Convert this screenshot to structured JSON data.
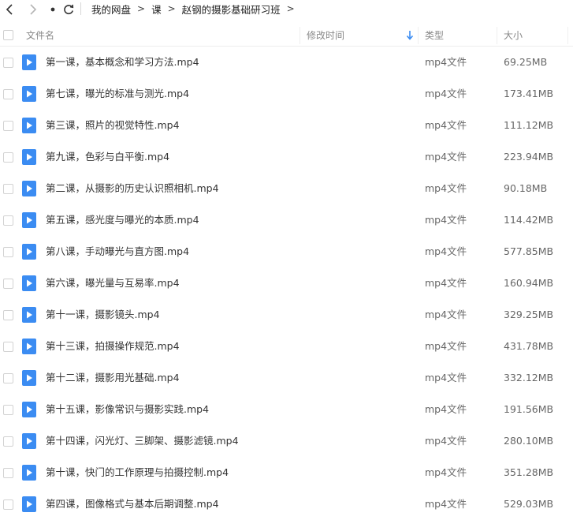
{
  "breadcrumb": {
    "items": [
      "我的网盘",
      "课",
      "赵钢的摄影基础研习班"
    ],
    "arrow": ">"
  },
  "columns": {
    "name": "文件名",
    "mtime": "修改时间",
    "type": "类型",
    "size": "大小"
  },
  "files": [
    {
      "name": "第一课，基本概念和学习方法.mp4",
      "type": "mp4文件",
      "size": "69.25MB"
    },
    {
      "name": "第七课，曝光的标准与测光.mp4",
      "type": "mp4文件",
      "size": "173.41MB"
    },
    {
      "name": "第三课，照片的视觉特性.mp4",
      "type": "mp4文件",
      "size": "111.12MB"
    },
    {
      "name": "第九课，色彩与白平衡.mp4",
      "type": "mp4文件",
      "size": "223.94MB"
    },
    {
      "name": "第二课，从摄影的历史认识照相机.mp4",
      "type": "mp4文件",
      "size": "90.18MB"
    },
    {
      "name": "第五课，感光度与曝光的本质.mp4",
      "type": "mp4文件",
      "size": "114.42MB"
    },
    {
      "name": "第八课，手动曝光与直方图.mp4",
      "type": "mp4文件",
      "size": "577.85MB"
    },
    {
      "name": "第六课，曝光量与互易率.mp4",
      "type": "mp4文件",
      "size": "160.94MB"
    },
    {
      "name": "第十一课，摄影镜头.mp4",
      "type": "mp4文件",
      "size": "329.25MB"
    },
    {
      "name": "第十三课，拍摄操作规范.mp4",
      "type": "mp4文件",
      "size": "431.78MB"
    },
    {
      "name": "第十二课，摄影用光基础.mp4",
      "type": "mp4文件",
      "size": "332.12MB"
    },
    {
      "name": "第十五课，影像常识与摄影实践.mp4",
      "type": "mp4文件",
      "size": "191.56MB"
    },
    {
      "name": "第十四课，闪光灯、三脚架、摄影滤镜.mp4",
      "type": "mp4文件",
      "size": "280.10MB"
    },
    {
      "name": "第十课，快门的工作原理与拍摄控制.mp4",
      "type": "mp4文件",
      "size": "351.28MB"
    },
    {
      "name": "第四课，图像格式与基本后期调整.mp4",
      "type": "mp4文件",
      "size": "529.03MB"
    }
  ],
  "colors": {
    "accent": "#3b8cf2",
    "text": "#333333",
    "muted": "#888888"
  },
  "icons": {
    "back": "chevron-left-icon",
    "forward": "chevron-right-icon",
    "history": "dot-icon",
    "refresh": "refresh-icon",
    "sort": "sort-down-icon",
    "file": "video-file-icon"
  }
}
